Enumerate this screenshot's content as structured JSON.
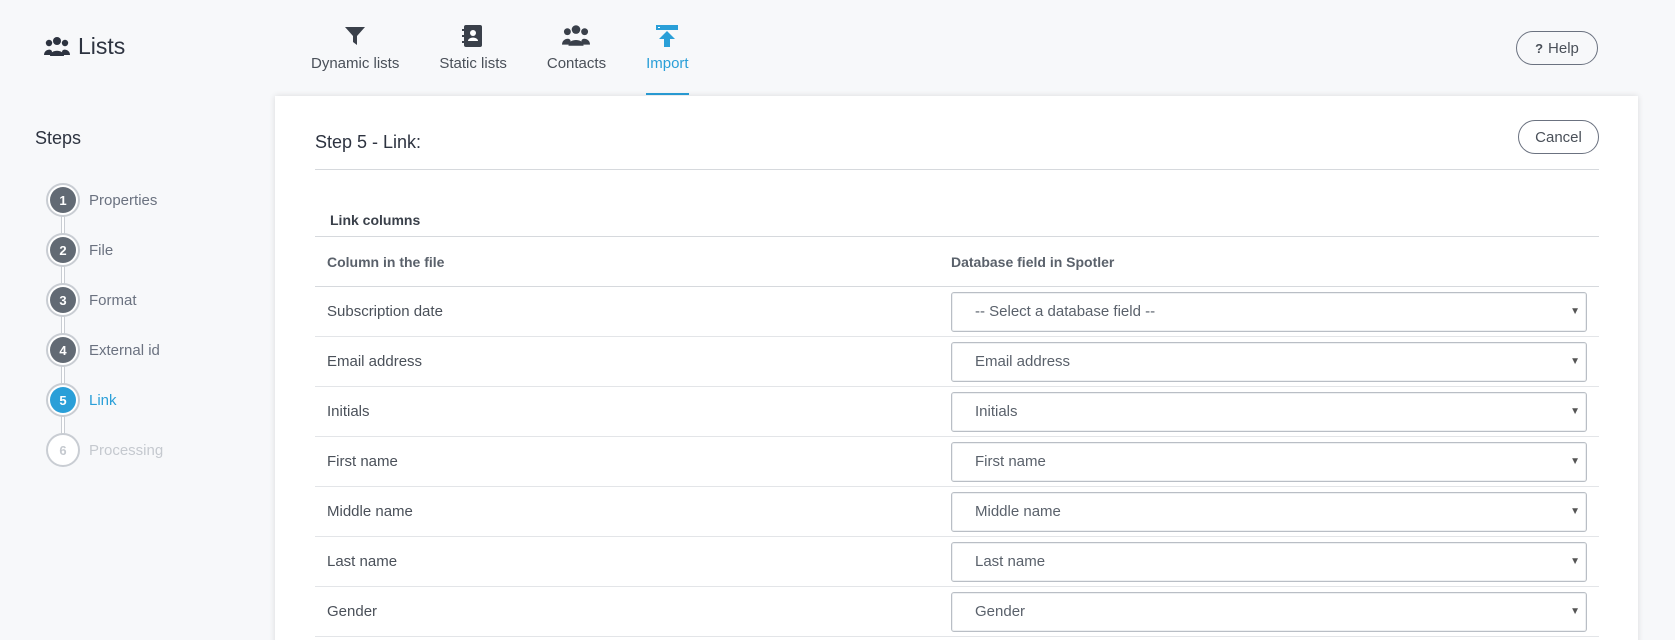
{
  "app": {
    "title": "Lists"
  },
  "nav": [
    {
      "label": "Dynamic lists",
      "icon": "filter-icon",
      "active": false
    },
    {
      "label": "Static lists",
      "icon": "address-book-icon",
      "active": false
    },
    {
      "label": "Contacts",
      "icon": "users-icon",
      "active": false
    },
    {
      "label": "Import",
      "icon": "upload-icon",
      "active": true
    }
  ],
  "help": {
    "label": "Help"
  },
  "steps": {
    "title": "Steps",
    "items": [
      {
        "num": "1",
        "label": "Properties",
        "state": "done"
      },
      {
        "num": "2",
        "label": "File",
        "state": "done"
      },
      {
        "num": "3",
        "label": "Format",
        "state": "done"
      },
      {
        "num": "4",
        "label": "External id",
        "state": "done"
      },
      {
        "num": "5",
        "label": "Link",
        "state": "active"
      },
      {
        "num": "6",
        "label": "Processing",
        "state": "pending"
      }
    ]
  },
  "main": {
    "title": "Step 5 - Link:",
    "cancel_label": "Cancel",
    "section_title": "Link columns",
    "headers": {
      "col1": "Column in the file",
      "col2": "Database field in Spotler"
    },
    "rows": [
      {
        "column": "Subscription date",
        "field": "-- Select a database field --"
      },
      {
        "column": "Email address",
        "field": "Email address"
      },
      {
        "column": "Initials",
        "field": "Initials"
      },
      {
        "column": "First name",
        "field": "First name"
      },
      {
        "column": "Middle name",
        "field": "Middle name"
      },
      {
        "column": "Last name",
        "field": "Last name"
      },
      {
        "column": "Gender",
        "field": "Gender"
      }
    ]
  },
  "colors": {
    "accent": "#2a9fd8",
    "dark": "#2d3340",
    "step": "#626a74"
  }
}
